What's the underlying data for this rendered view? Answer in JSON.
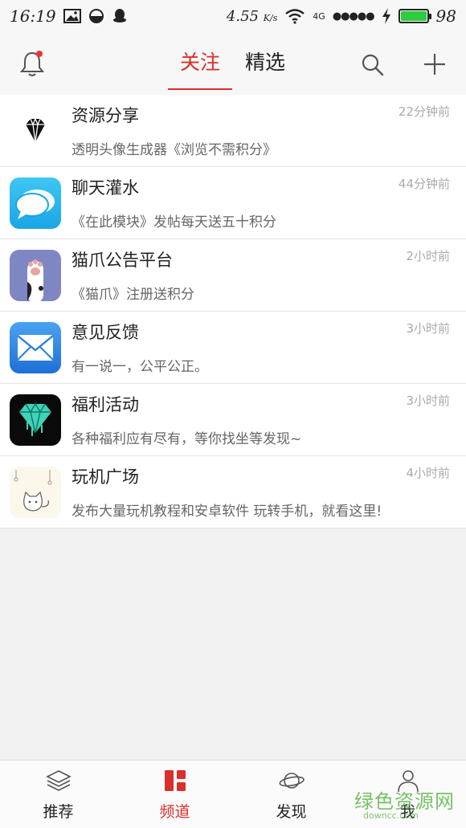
{
  "status_bar": {
    "time": "16:19",
    "net_speed": "4.55",
    "net_speed_unit": "K/s",
    "network": "4G",
    "signal_dots": "●●●●●",
    "battery": "98"
  },
  "header": {
    "tab_follow": "关注",
    "tab_select": "精选"
  },
  "channels": [
    {
      "name": "资源分享",
      "time": "22分钟前",
      "desc": "透明头像生成器《浏览不需积分》",
      "icon": "diamond-icon"
    },
    {
      "name": "聊天灌水",
      "time": "44分钟前",
      "desc": "《在此模块》发帖每天送五十积分",
      "icon": "chat-bubbles-icon"
    },
    {
      "name": "猫爪公告平台",
      "time": "2小时前",
      "desc": "《猫爪》注册送积分",
      "icon": "cat-paw-icon"
    },
    {
      "name": "意见反馈",
      "time": "3小时前",
      "desc": "有一说一，公平公正。",
      "icon": "mail-icon"
    },
    {
      "name": "福利活动",
      "time": "3小时前",
      "desc": "各种福利应有尽有，等你找坐等发现~",
      "icon": "teal-diamond-icon"
    },
    {
      "name": "玩机广场",
      "time": "4小时前",
      "desc": "发布大量玩机教程和安卓软件 玩转手机，就看这里!",
      "icon": "cat-doodle-icon"
    }
  ],
  "bottom_nav": {
    "recommend": "推荐",
    "channel": "频道",
    "discover": "发现",
    "me": "我"
  },
  "watermark": {
    "text": "绿色资源网",
    "url": "downcc.com"
  },
  "colors": {
    "accent": "#d9302c",
    "battery": "#2ecc40"
  }
}
